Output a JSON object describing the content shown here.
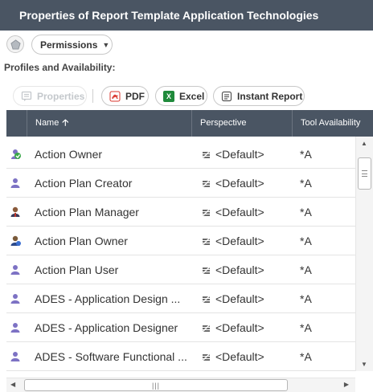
{
  "window": {
    "title": "Properties of Report Template Application Technologies"
  },
  "permissions": {
    "label": "Permissions",
    "icon": "pentagon-icon"
  },
  "section": {
    "label": "Profiles and Availability:"
  },
  "toolbar": {
    "properties_label": "Properties",
    "pdf_label": "PDF",
    "excel_label": "Excel",
    "instant_report_label": "Instant Report"
  },
  "grid": {
    "columns": {
      "name": "Name",
      "perspective": "Perspective",
      "tool_availability": "Tool Availability"
    },
    "sort": {
      "column": "name",
      "direction": "ascending"
    },
    "rows": [
      {
        "name": "Action Owner",
        "perspective": "<Default>",
        "tool": "*A",
        "icon": "user-group-green-icon"
      },
      {
        "name": "Action Plan Creator",
        "perspective": "<Default>",
        "tool": "*A",
        "icon": "user-icon"
      },
      {
        "name": "Action Plan Manager",
        "perspective": "<Default>",
        "tool": "*A",
        "icon": "user-manager-icon"
      },
      {
        "name": "Action Plan Owner",
        "perspective": "<Default>",
        "tool": "*A",
        "icon": "user-owner-icon"
      },
      {
        "name": "Action Plan User",
        "perspective": "<Default>",
        "tool": "*A",
        "icon": "user-icon"
      },
      {
        "name": "ADES - Application Design ...",
        "perspective": "<Default>",
        "tool": "*A",
        "icon": "user-icon"
      },
      {
        "name": "ADES - Application Designer",
        "perspective": "<Default>",
        "tool": "*A",
        "icon": "user-icon"
      },
      {
        "name": "ADES - Software Functional ...",
        "perspective": "<Default>",
        "tool": "*A",
        "icon": "user-icon"
      }
    ]
  },
  "colors": {
    "header_bg": "#4a5563",
    "pdf_red": "#d9342b",
    "excel_green": "#1f8a3b",
    "user_purple": "#7d72c4"
  }
}
